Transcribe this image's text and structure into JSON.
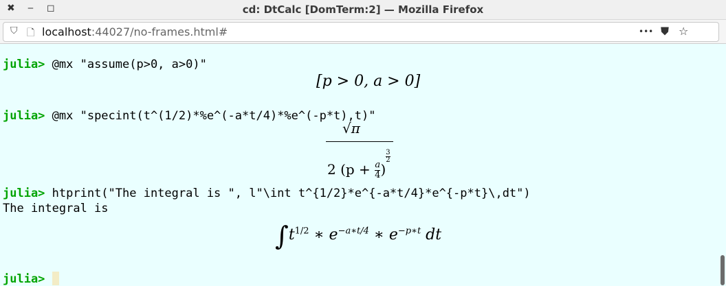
{
  "window": {
    "title": "cd: DtCalc  [DomTerm:2] — Mozilla Firefox",
    "close_icon": "✖",
    "minimize_icon": "‒",
    "maximize_icon": "◻"
  },
  "urlbar": {
    "host": "localhost",
    "rest": ":44027/no-frames.html#",
    "shield_icon": "⛉",
    "page_icon": "🗋",
    "more_icon": "•••",
    "pocket_icon": "⛊",
    "star_icon": "☆"
  },
  "terminal": {
    "prompt": "julia>",
    "cmd1": " @mx \"assume(p>0, a>0)\"",
    "out1": "[p > 0, a > 0]",
    "cmd2": " @mx \"specint(t^(1/2)*%e^(-a*t/4)*%e^(-p*t),t)\"",
    "out2": {
      "numerator": "√π",
      "denom_prefix": "2 (p + ",
      "a": "a",
      "four": "4",
      "close": ")",
      "exp_num": "3",
      "exp_den": "2"
    },
    "cmd3": " htprint(\"The integral is \", l\"\\int t^{1/2}*e^{-a*t/4}*e^{-p*t}\\,dt\")",
    "text3": "The integral is",
    "out3": {
      "integral": "∫",
      "t": "t",
      "t_exp": "1/2",
      "star1": " ∗ ",
      "e1": "e",
      "e1_exp": "−a∗t/4",
      "star2": " ∗ ",
      "e2": "e",
      "e2_exp": "−p∗t",
      "dt": " dt"
    }
  }
}
